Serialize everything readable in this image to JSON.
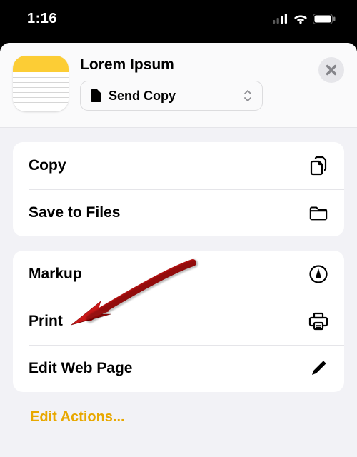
{
  "status": {
    "time": "1:16"
  },
  "header": {
    "title": "Lorem Ipsum",
    "format_label": "Send Copy"
  },
  "groups": [
    {
      "items": [
        {
          "label": "Copy",
          "icon": "copy"
        },
        {
          "label": "Save to Files",
          "icon": "folder"
        }
      ]
    },
    {
      "items": [
        {
          "label": "Markup",
          "icon": "markup"
        },
        {
          "label": "Print",
          "icon": "print"
        },
        {
          "label": "Edit Web Page",
          "icon": "pencil"
        }
      ]
    }
  ],
  "footer": {
    "edit_actions": "Edit Actions..."
  }
}
